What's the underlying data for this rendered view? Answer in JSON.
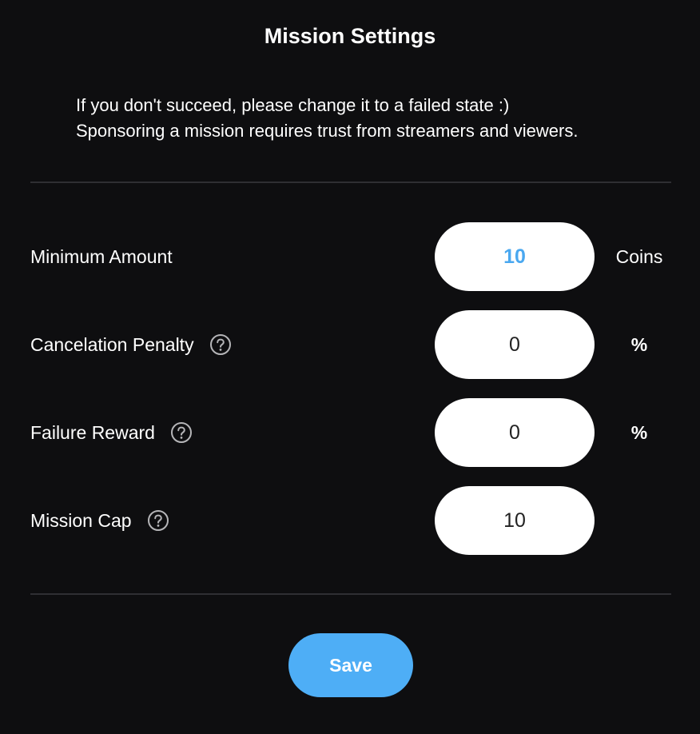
{
  "header": {
    "title": "Mission Settings"
  },
  "notice": {
    "line1": "If you don't succeed, please change it to a failed state :)",
    "line2": "Sponsoring a mission requires trust from streamers and viewers."
  },
  "settings": {
    "minimum_amount": {
      "label": "Minimum Amount",
      "value": "10",
      "unit": "Coins"
    },
    "cancelation_penalty": {
      "label": "Cancelation Penalty",
      "value": "0",
      "unit": "%",
      "help_icon": "question-circle-icon"
    },
    "failure_reward": {
      "label": "Failure Reward",
      "value": "0",
      "unit": "%",
      "help_icon": "question-circle-icon"
    },
    "mission_cap": {
      "label": "Mission Cap",
      "value": "10",
      "help_icon": "question-circle-icon"
    }
  },
  "actions": {
    "save_label": "Save"
  },
  "colors": {
    "background": "#0e0e10",
    "accent": "#4eaef6",
    "accent_text": "#4aa8f0",
    "divider": "#2f2f33"
  }
}
